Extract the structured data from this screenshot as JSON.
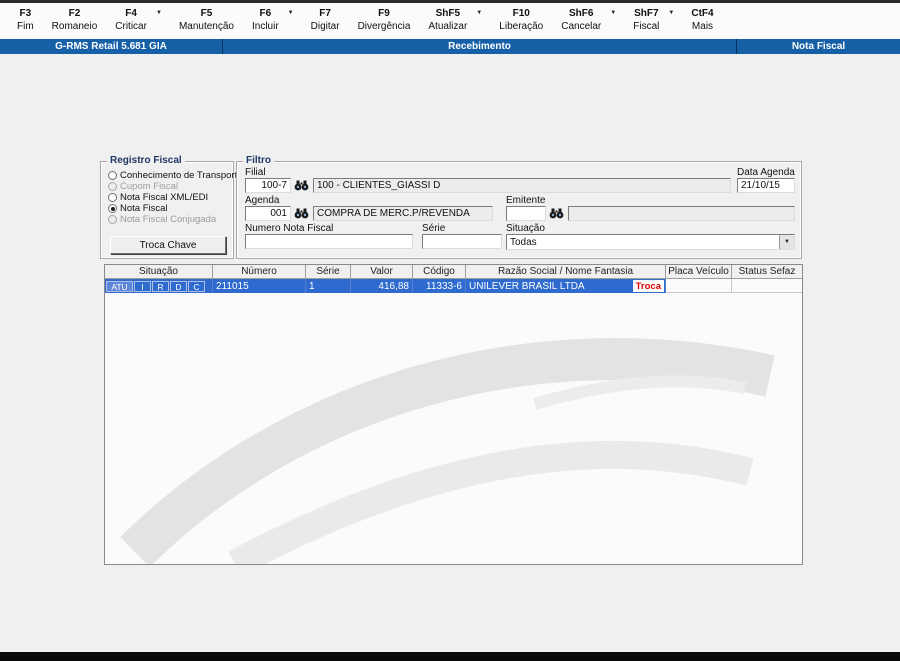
{
  "colors": {
    "titlebar_blue": "#1660a8",
    "selection_blue": "#2f6bce",
    "troca_red": "#e00000"
  },
  "icons": {
    "dropdown_arrow": "▼",
    "combo_arrow": "▼",
    "lookup": "binoculars-icon"
  },
  "toolbar": {
    "items": [
      {
        "key": "F3",
        "label": "Fim"
      },
      {
        "key": "F2",
        "label": "Romaneio"
      },
      {
        "key": "F4",
        "label": "Criticar",
        "arrow": true
      },
      {
        "key": "F5",
        "label": "Manutenção"
      },
      {
        "key": "F6",
        "label": "Incluir",
        "arrow": true
      },
      {
        "key": "F7",
        "label": "Digitar"
      },
      {
        "key": "F9",
        "label": "Divergência"
      },
      {
        "key": "ShF5",
        "label": "Atualizar",
        "arrow": true
      },
      {
        "key": "F10",
        "label": "Liberação"
      },
      {
        "key": "ShF6",
        "label": "Cancelar",
        "arrow": true
      },
      {
        "key": "ShF7",
        "label": "Fiscal",
        "arrow": true
      },
      {
        "key": "CtF4",
        "label": "Mais"
      }
    ]
  },
  "titlebar": {
    "left": "G-RMS Retail 5.681 GIA",
    "center": "Recebimento",
    "right": "Nota Fiscal"
  },
  "registro_fiscal": {
    "title": "Registro Fiscal",
    "options": [
      {
        "label": "Conhecimento de Transporte",
        "selected": false,
        "disabled": false
      },
      {
        "label": "Cupom Fiscal",
        "selected": false,
        "disabled": true
      },
      {
        "label": "Nota Fiscal XML/EDI",
        "selected": false,
        "disabled": false
      },
      {
        "label": "Nota Fiscal",
        "selected": true,
        "disabled": false
      },
      {
        "label": "Nota Fiscal Conjugada",
        "selected": false,
        "disabled": true
      }
    ],
    "button": "Troca Chave"
  },
  "filtro": {
    "title": "Filtro",
    "filial_label": "Filial",
    "filial_code": "100-7",
    "filial_name": "100 - CLIENTES_GIASSI D",
    "data_agenda_label": "Data Agenda",
    "data_agenda_value": "21/10/15",
    "agenda_label": "Agenda",
    "agenda_code": "001",
    "agenda_name": "COMPRA DE MERC.P/REVENDA",
    "emitente_label": "Emitente",
    "emitente_code": "",
    "emitente_name": "",
    "numero_label": "Numero Nota Fiscal",
    "numero_value": "",
    "serie_label": "Série",
    "serie_value": "",
    "situacao_label": "Situação",
    "situacao_value": "Todas"
  },
  "grid": {
    "headers": [
      "Situação",
      "Número",
      "Série",
      "Valor",
      "Código",
      "Razão Social / Nome Fantasia",
      "Placa Veículo",
      "Status Sefaz"
    ],
    "rows": [
      {
        "situacao": [
          "ATU",
          "I",
          "R",
          "D",
          "C"
        ],
        "numero": "211015",
        "serie": "1",
        "valor": "416,88",
        "codigo": "11333-6",
        "razao": "UNILEVER BRASIL LTDA",
        "badge": "Troca",
        "placa": "",
        "status_sefaz": ""
      }
    ]
  }
}
